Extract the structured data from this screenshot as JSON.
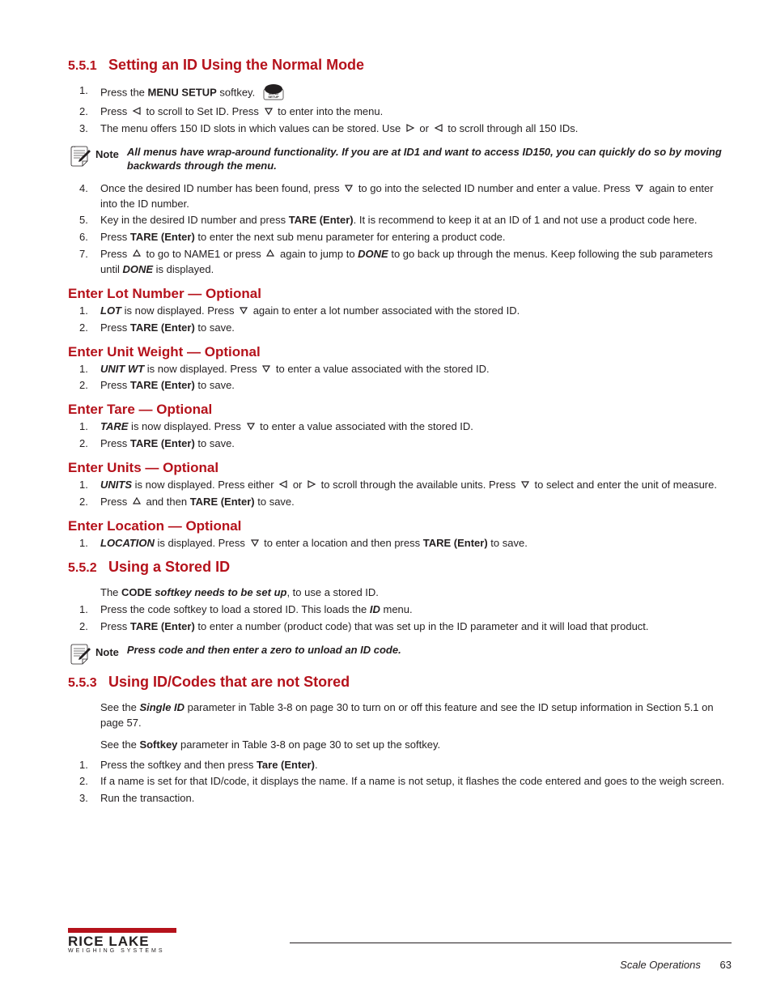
{
  "headings": {
    "h551_num": "5.5.1",
    "h551_title": "Setting an ID Using the Normal Mode",
    "h552_num": "5.5.2",
    "h552_title": "Using a Stored ID",
    "h553_num": "5.5.3",
    "h553_title": "Using ID/Codes that are not Stored",
    "lot": "Enter Lot Number — Optional",
    "unitwt": "Enter Unit Weight — Optional",
    "tare": "Enter Tare — Optional",
    "units": "Enter Units — Optional",
    "location": "Enter Location — Optional"
  },
  "step551": {
    "s1a": "1.",
    "s1b": "Press the ",
    "s1c": "MENU SETUP",
    "s1d": " softkey. ",
    "s2a": "2.",
    "s2b": "Press ",
    "s2c": " to scroll to Set ID. Press ",
    "s2d": " to enter into the menu.",
    "s3a": "3.",
    "s3b": "The menu offers 150 ID slots in which values can be stored. Use ",
    "s3c": " or ",
    "s3d": " to scroll through all 150 IDs.",
    "s4a": "4.",
    "s4b": "Once the desired ID number has been found, press ",
    "s4c": " to go into the selected ID number and enter a value. Press ",
    "s4d": " again to enter into the ID number.",
    "s5a": "5.",
    "s5b": "Key in the desired ID number and press ",
    "s5c": "TARE (Enter)",
    "s5d": ". It is recommend to keep it at an ID of 1 and not use a product code here.",
    "s6a": "6.",
    "s6b": "Press ",
    "s6c": "TARE (Enter)",
    "s6d": " to enter the next sub menu parameter for entering a product code.",
    "s7a": "7.",
    "s7b": "Press ",
    "s7c": " to go to NAME1 or press ",
    "s7d": " again to jump to ",
    "s7e": "DONE",
    "s7f": " to go back up through the menus. Keep following the sub parameters until ",
    "s7g": "DONE",
    "s7h": " is displayed."
  },
  "lot": {
    "s1a": "1.",
    "s1b": "LOT",
    "s1c": " is now displayed. Press ",
    "s1d": " again to enter a lot number associated with the stored ID.",
    "s2a": "2.",
    "s2b": "Press ",
    "s2c": "TARE (Enter)",
    "s2d": " to save."
  },
  "unitwt": {
    "s1a": "1.",
    "s1b": "UNIT WT",
    "s1c": " is now displayed. Press ",
    "s1d": " to enter a value associated with the stored ID.",
    "s2a": "2.",
    "s2b": "Press ",
    "s2c": "TARE (Enter)",
    "s2d": " to save."
  },
  "taresec": {
    "s1a": "1.",
    "s1b": "TARE",
    "s1c": " is now displayed. Press ",
    "s1d": " to enter a value associated with the stored ID.",
    "s2a": "2.",
    "s2b": "Press ",
    "s2c": "TARE (Enter)",
    "s2d": " to save."
  },
  "units": {
    "s1a": "1.",
    "s1b": "UNITS",
    "s1c": " is now displayed. Press either ",
    "s1d": " or ",
    "s1e": " to scroll through the available units. Press ",
    "s1f": " to select and enter the unit of measure.",
    "s2a": "2.",
    "s2b": "Press ",
    "s2c": " and then ",
    "s2d": "TARE (Enter)",
    "s2e": " to save."
  },
  "location": {
    "s1a": "1.",
    "s1b": "LOCATION",
    "s1c": " is displayed. Press ",
    "s1d": " to enter a location and then press ",
    "s1e": "TARE (Enter)",
    "s1f": " to save."
  },
  "step552": {
    "pre": "The ",
    "pre2": "CODE ",
    "pre3": " softkey needs to be set up",
    "pre4": ", to use a stored ID.",
    "s1a": "1.",
    "s1b": "Press the code softkey to load a stored ID. This loads the ",
    "s1c": "ID",
    "s1d": " menu.",
    "s2a": "2.",
    "s2b": "Press ",
    "s2c": "TARE (Enter)",
    "s2d": " to enter a number (product code) that was set up in the ID parameter and it will load that product."
  },
  "note1": "All menus have wrap-around functionality. If you are at ID1 and want to access ID150, you can quickly do so by moving backwards through the menu.",
  "note2": "Press code and then enter a zero to unload an ID code.",
  "note_label": "Note",
  "step553": {
    "pre1": "See the ",
    "pre2": "Single ID",
    "pre3": " parameter in Table 3-8 on page 30 to turn on or off this feature and see the ID setup information in Section 5.1 on page 57.",
    "pre4": "See the ",
    "pre5": "Softkey",
    "pre6": " parameter in Table 3-8 on page 30 to set up the softkey.",
    "s1a": "1.",
    "s1b": "Press the softkey and then press ",
    "s1c": "Tare (Enter)",
    "s1d": ".",
    "s2a": "2.",
    "s2b": "If a name is set for that ID/code, it displays the name. If a name is not setup, it flashes the code entered and goes to the weigh screen.",
    "s3a": "3.",
    "s3b": "Run the transaction."
  },
  "footer": {
    "right": "Scale Operations",
    "page": "63"
  }
}
